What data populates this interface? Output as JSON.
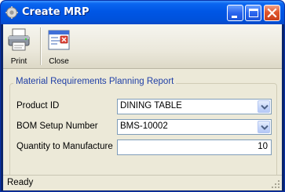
{
  "window": {
    "title": "Create MRP",
    "controls": [
      "minimize",
      "maximize",
      "close"
    ]
  },
  "toolbar": {
    "print_label": "Print",
    "close_label": "Close"
  },
  "form": {
    "group_title": "Material Requirements Planning Report",
    "product_id_label": "Product ID",
    "product_id_value": "DINING TABLE",
    "bom_label": "BOM Setup Number",
    "bom_value": "BMS-10002",
    "qty_label": "Quantity to Manufacture",
    "qty_value": "10"
  },
  "status": {
    "text": "Ready"
  },
  "colors": {
    "titlebar": "#0058e6",
    "client_background": "#ece9d8",
    "group_title": "#1f3fa6",
    "field_border": "#7f9db9",
    "close_button": "#e0562c"
  }
}
